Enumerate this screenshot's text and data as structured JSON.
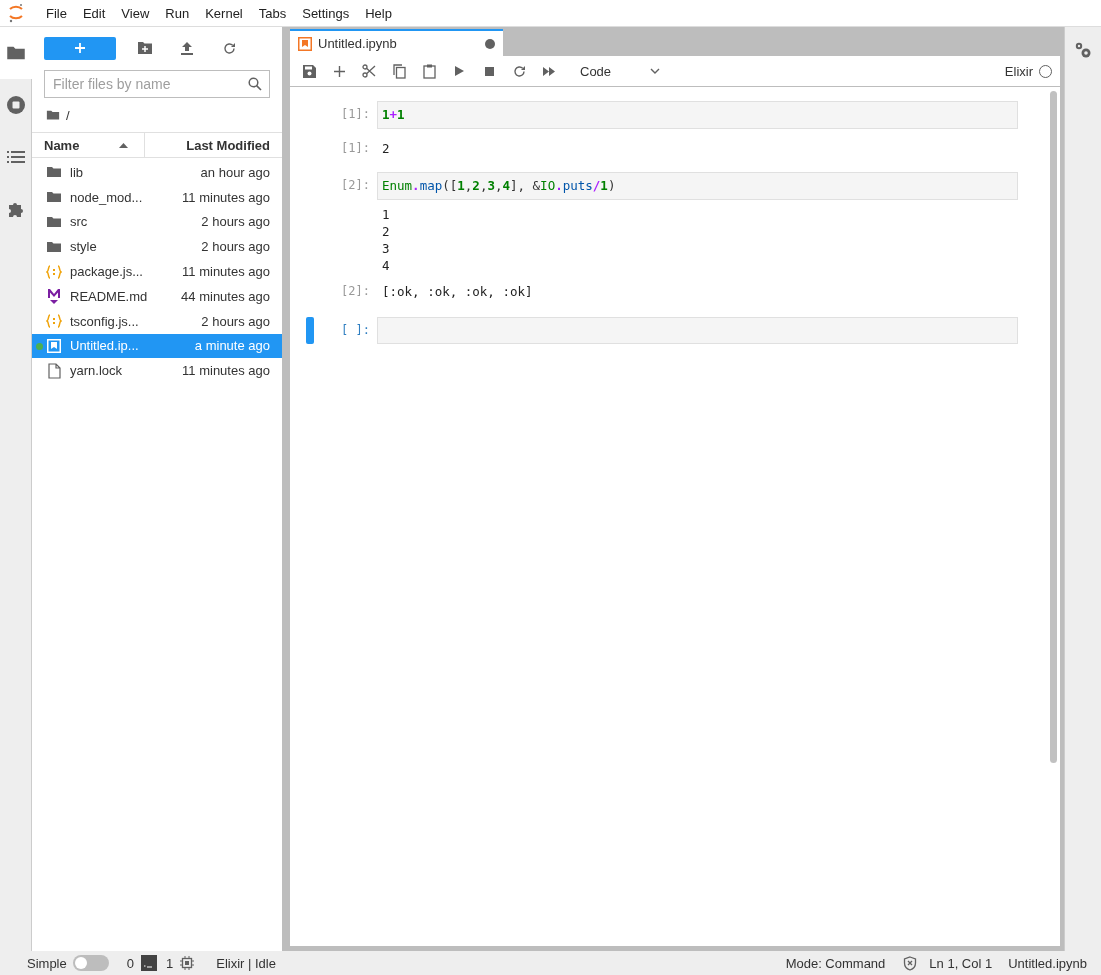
{
  "menu": [
    "File",
    "Edit",
    "View",
    "Run",
    "Kernel",
    "Tabs",
    "Settings",
    "Help"
  ],
  "left_tabs": [
    {
      "kind": "folder",
      "selected": true
    },
    {
      "kind": "stop",
      "selected": false
    },
    {
      "kind": "list",
      "selected": false
    },
    {
      "kind": "puzzle",
      "selected": false
    }
  ],
  "file_browser": {
    "filter_placeholder": "Filter files by name",
    "path": "/",
    "columns": [
      {
        "label": "Name",
        "sorted": true
      },
      {
        "label": "Last Modified",
        "sorted": false
      }
    ],
    "files": [
      {
        "name": "lib",
        "modified": "an hour ago",
        "kind": "folder",
        "selected": false,
        "running": false
      },
      {
        "name": "node_mod...",
        "modified": "11 minutes ago",
        "kind": "folder",
        "selected": false,
        "running": false
      },
      {
        "name": "src",
        "modified": "2 hours ago",
        "kind": "folder",
        "selected": false,
        "running": false
      },
      {
        "name": "style",
        "modified": "2 hours ago",
        "kind": "folder",
        "selected": false,
        "running": false
      },
      {
        "name": "package.js...",
        "modified": "11 minutes ago",
        "kind": "json",
        "selected": false,
        "running": false
      },
      {
        "name": "README.md",
        "modified": "44 minutes ago",
        "kind": "markdown",
        "selected": false,
        "running": false
      },
      {
        "name": "tsconfig.js...",
        "modified": "2 hours ago",
        "kind": "json",
        "selected": false,
        "running": false
      },
      {
        "name": "Untitled.ip...",
        "modified": "a minute ago",
        "kind": "notebook",
        "selected": true,
        "running": true
      },
      {
        "name": "yarn.lock",
        "modified": "11 minutes ago",
        "kind": "file",
        "selected": false,
        "running": false
      }
    ]
  },
  "notebook_tab": {
    "title": "Untitled.ipynb",
    "selected": true,
    "modified": true
  },
  "toolbar": {
    "cell_type": "Code",
    "kernel": "Elixir",
    "kernel_busy": false
  },
  "cells": [
    {
      "kind": "code",
      "prompt": "[1]:",
      "active": false,
      "tokens": [
        {
          "kind": "number",
          "text": "1"
        },
        {
          "kind": "operator",
          "text": "+"
        },
        {
          "kind": "number",
          "text": "1"
        }
      ]
    },
    {
      "kind": "result",
      "prompt": "[1]:",
      "text": "2"
    },
    {
      "kind": "code",
      "prompt": "[2]:",
      "active": false,
      "tokens": [
        {
          "kind": "module",
          "text": "Enum"
        },
        {
          "kind": "operator",
          "text": "."
        },
        {
          "kind": "function",
          "text": "map"
        },
        {
          "kind": "plain",
          "text": "(["
        },
        {
          "kind": "number",
          "text": "1"
        },
        {
          "kind": "plain",
          "text": ","
        },
        {
          "kind": "number",
          "text": "2"
        },
        {
          "kind": "plain",
          "text": ","
        },
        {
          "kind": "number",
          "text": "3"
        },
        {
          "kind": "plain",
          "text": ","
        },
        {
          "kind": "number",
          "text": "4"
        },
        {
          "kind": "plain",
          "text": "], &"
        },
        {
          "kind": "module",
          "text": "IO"
        },
        {
          "kind": "operator",
          "text": "."
        },
        {
          "kind": "function",
          "text": "puts"
        },
        {
          "kind": "operator",
          "text": "/"
        },
        {
          "kind": "number",
          "text": "1"
        },
        {
          "kind": "plain",
          "text": ")"
        }
      ]
    },
    {
      "kind": "stream",
      "text": "1\n2\n3\n4"
    },
    {
      "kind": "result",
      "prompt": "[2]:",
      "text": "[:ok, :ok, :ok, :ok]"
    },
    {
      "kind": "code",
      "prompt": "[ ]:",
      "active": true
    }
  ],
  "status_bar": {
    "simple_label": "Simple",
    "simple_on": false,
    "terminals": "0",
    "kernels": "1",
    "kernel_status": "Elixir | Idle",
    "mode": "Mode: Command",
    "position": "Ln 1, Col 1",
    "file": "Untitled.ipynb"
  }
}
